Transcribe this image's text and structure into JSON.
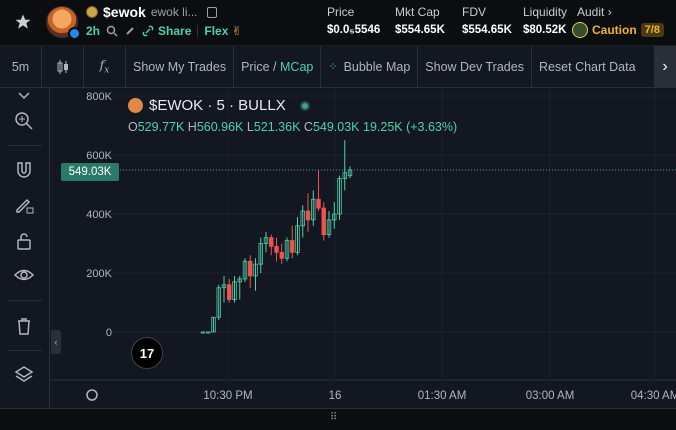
{
  "header": {
    "symbol": "$ewok",
    "name": "ewok li...",
    "age": "2h",
    "share_label": "Share",
    "flex_label": "Flex",
    "stats": [
      {
        "label": "Price",
        "value": "$0.0₅5546"
      },
      {
        "label": "Mkt Cap",
        "value": "$554.65K"
      },
      {
        "label": "FDV",
        "value": "$554.65K"
      },
      {
        "label": "Liquidity",
        "value": "$80.52K"
      }
    ],
    "audit_label": "Audit",
    "caution_label": "Caution",
    "caution_score": "7/8"
  },
  "toolbar": {
    "interval": "5m",
    "show_my_trades": "Show My Trades",
    "price_label": "Price",
    "slash": " / ",
    "mcap_label": "MCap",
    "bubble_map": "Bubble Map",
    "show_dev_trades": "Show Dev Trades",
    "reset_chart": "Reset Chart Data"
  },
  "legend": {
    "title": "$EWOK · 5 · BULLX",
    "o_label": "O",
    "o": "529.77K",
    "h_label": "H",
    "h": "560.96K",
    "l_label": "L",
    "l": "521.36K",
    "c_label": "C",
    "c": "549.03K",
    "change": "19.25K (+3.63%)"
  },
  "price_tag": "549.03K",
  "tv_logo": "17",
  "chart_data": {
    "type": "candlestick",
    "y_ticks": [
      "800K",
      "600K",
      "400K",
      "200K",
      "0"
    ],
    "x_ticks": [
      "10:30 PM",
      "16",
      "01:30 AM",
      "03:00 AM",
      "04:30 AM"
    ],
    "ylim": [
      0,
      800000
    ],
    "current_value": 549030,
    "candles": [
      [
        0,
        0,
        0,
        0
      ],
      [
        0,
        0,
        0,
        0
      ],
      [
        0,
        50,
        0,
        50
      ],
      [
        50,
        160,
        40,
        150
      ],
      [
        150,
        190,
        100,
        160
      ],
      [
        160,
        180,
        100,
        110
      ],
      [
        110,
        190,
        100,
        170
      ],
      [
        170,
        190,
        110,
        180
      ],
      [
        180,
        250,
        170,
        240
      ],
      [
        240,
        260,
        150,
        190
      ],
      [
        190,
        250,
        140,
        230
      ],
      [
        230,
        320,
        200,
        300
      ],
      [
        300,
        340,
        270,
        320
      ],
      [
        320,
        330,
        260,
        290
      ],
      [
        290,
        320,
        240,
        270
      ],
      [
        270,
        300,
        230,
        250
      ],
      [
        250,
        320,
        240,
        310
      ],
      [
        310,
        360,
        250,
        270
      ],
      [
        270,
        390,
        260,
        360
      ],
      [
        360,
        430,
        320,
        410
      ],
      [
        410,
        470,
        340,
        380
      ],
      [
        380,
        480,
        360,
        450
      ],
      [
        450,
        550,
        410,
        420
      ],
      [
        420,
        440,
        310,
        330
      ],
      [
        330,
        410,
        320,
        380
      ],
      [
        380,
        440,
        350,
        400
      ],
      [
        400,
        530,
        380,
        520
      ],
      [
        520,
        650,
        480,
        540
      ],
      [
        529.77,
        560.96,
        521.36,
        549.03
      ]
    ]
  }
}
